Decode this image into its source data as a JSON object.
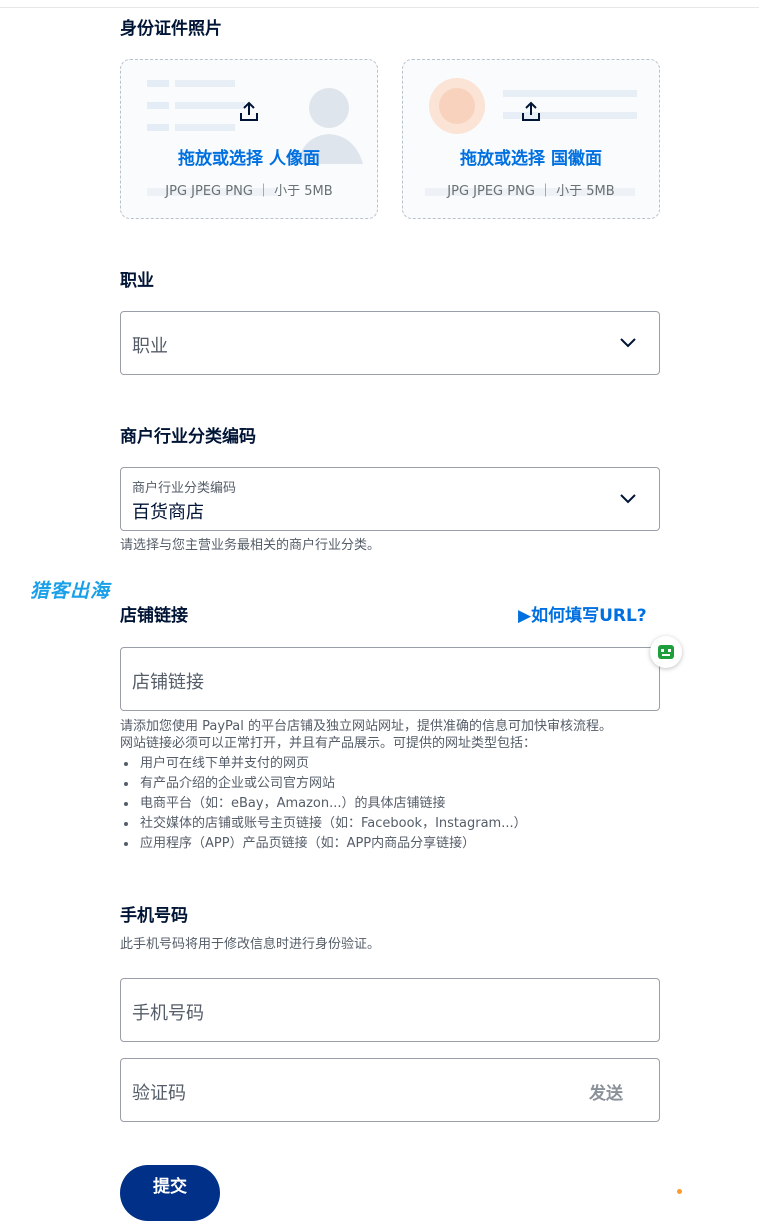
{
  "id_photo": {
    "title": "身份证件照片",
    "front": {
      "label": "拖放或选择 人像面",
      "hint": "JPG JPEG PNG ｜ 小于 5MB"
    },
    "back": {
      "label": "拖放或选择 国徽面",
      "hint": "JPG JPEG PNG ｜ 小于 5MB"
    }
  },
  "occupation": {
    "title": "职业",
    "placeholder": "职业"
  },
  "mcc": {
    "title": "商户行业分类编码",
    "float_label": "商户行业分类编码",
    "value": "百货商店",
    "helper": "请选择与您主营业务最相关的商户行业分类。"
  },
  "watermark": "猎客出海",
  "store": {
    "title": "店铺链接",
    "howto_link": "▶如何填写URL?",
    "placeholder": "店铺链接",
    "helper_line1": "请添加您使用 PayPal 的平台店铺及独立网站网址，提供准确的信息可加快审核流程。",
    "helper_line2": "网站链接必须可以正常打开，并且有产品展示。可提供的网址类型包括：",
    "bullets": [
      "用户可在线下单并支付的网页",
      "有产品介绍的企业或公司官方网站",
      "电商平台（如：eBay，Amazon...）的具体店铺链接",
      "社交媒体的店铺或账号主页链接（如：Facebook，Instagram...）",
      "应用程序（APP）产品页链接（如：APP内商品分享链接）"
    ]
  },
  "phone": {
    "title": "手机号码",
    "helper": "此手机号码将用于修改信息时进行身份验证。",
    "placeholder": "手机号码",
    "code_placeholder": "验证码",
    "send_label": "发送"
  },
  "submit_label": "提交",
  "colors": {
    "primary_blue": "#0070e0",
    "dark_navy": "#001435",
    "submit_bg": "#003087",
    "watermark": "#1aa0e8"
  }
}
